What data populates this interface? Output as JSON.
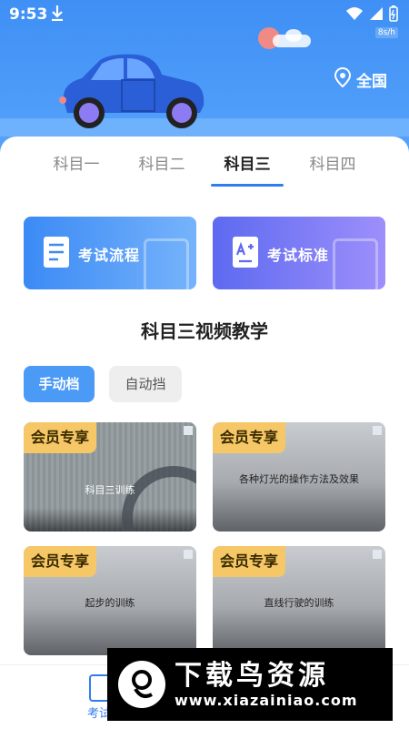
{
  "status_bar": {
    "time": "9:53",
    "speed": "8s/h"
  },
  "header": {
    "location": "全国"
  },
  "tabs": [
    {
      "label": "科目一"
    },
    {
      "label": "科目二"
    },
    {
      "label": "科目三"
    },
    {
      "label": "科目四"
    }
  ],
  "active_tab": "科目三",
  "cards": {
    "flow_label": "考试流程",
    "standard_label": "考试标准"
  },
  "section_title": "科目三视频教学",
  "filters": {
    "manual": "手动档",
    "auto": "自动挡"
  },
  "videos": [
    {
      "badge": "会员专享",
      "title": "科目三训练"
    },
    {
      "badge": "会员专享",
      "title": "各种灯光的操作方法及效果"
    },
    {
      "badge": "会员专享",
      "title": "起步的训练"
    },
    {
      "badge": "会员专享",
      "title": "直线行驶的训练"
    }
  ],
  "bottom_nav": {
    "label": "考试"
  },
  "watermark": {
    "title": "下载鸟资源",
    "url": "www.xiazainiao.com"
  },
  "colors": {
    "primary": "#3f8ff5",
    "accent": "#2f7ef0",
    "badge": "#f5c766"
  }
}
